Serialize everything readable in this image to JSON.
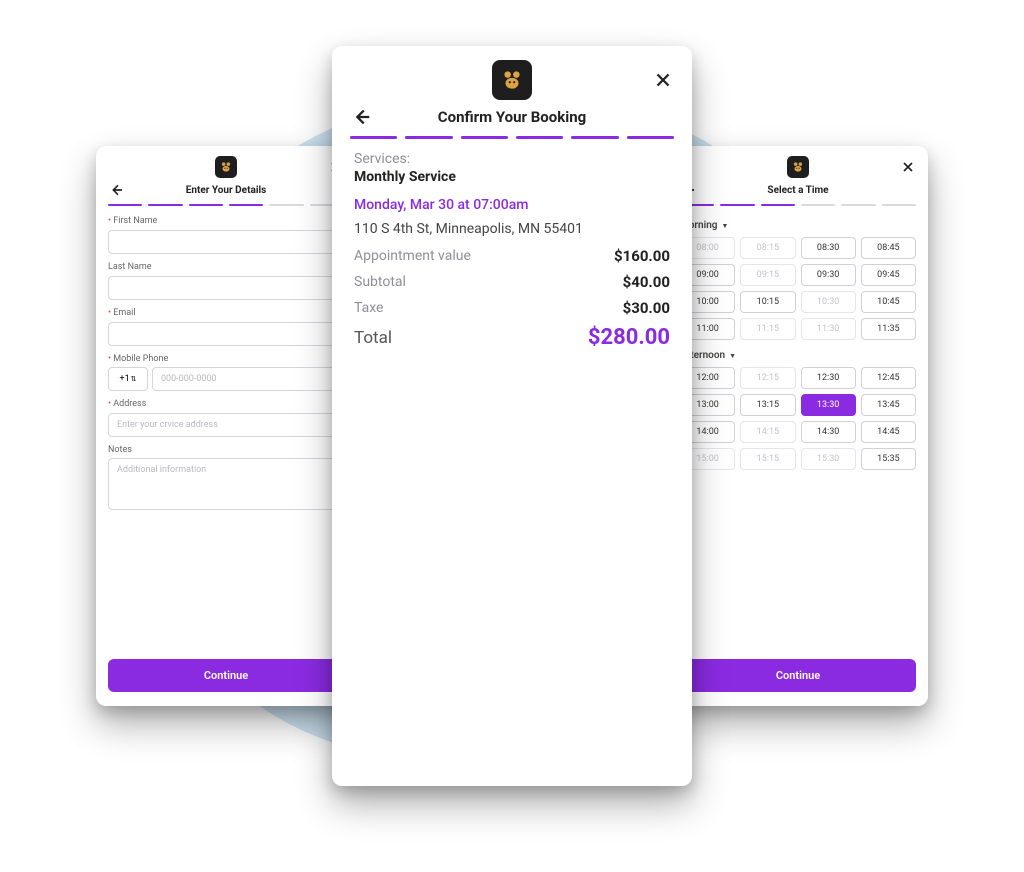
{
  "left": {
    "title": "Enter Your Details",
    "progress": [
      true,
      true,
      true,
      true,
      false,
      false
    ],
    "labels": {
      "first_name": "First Name",
      "last_name": "Last Name",
      "email": "Email",
      "phone": "Mobile Phone",
      "address": "Address",
      "notes": "Notes"
    },
    "phone_cc": "+1",
    "phone_placeholder": "000-000-0000",
    "address_placeholder": "Enter your crvice address",
    "notes_placeholder": "Additional information",
    "continue": "Continue"
  },
  "center": {
    "title": "Confirm Your Booking",
    "progress": [
      true,
      true,
      true,
      true,
      true,
      true
    ],
    "services_label": "Services:",
    "service_name": "Monthly Service",
    "datetime": "Monday, Mar 30 at 07:00am",
    "address": "110 S 4th St, Minneapolis, MN 55401",
    "lines": {
      "appt_label": "Appointment value",
      "appt_value": "$160.00",
      "subtotal_label": "Subtotal",
      "subtotal_value": "$40.00",
      "tax_label": "Taxe",
      "tax_value": "$30.00",
      "total_label": "Total",
      "total_value": "$280.00"
    }
  },
  "right": {
    "title": "Select a Time",
    "progress": [
      true,
      true,
      true,
      false,
      false,
      false
    ],
    "continue": "Continue",
    "groups": [
      {
        "label": "Morning",
        "slots": [
          {
            "t": "08:00",
            "d": true
          },
          {
            "t": "08:15",
            "d": true
          },
          {
            "t": "08:30"
          },
          {
            "t": "08:45"
          },
          {
            "t": "09:00"
          },
          {
            "t": "09:15",
            "d": true
          },
          {
            "t": "09:30"
          },
          {
            "t": "09:45"
          },
          {
            "t": "10:00"
          },
          {
            "t": "10:15"
          },
          {
            "t": "10:30",
            "d": true
          },
          {
            "t": "10:45"
          },
          {
            "t": "11:00"
          },
          {
            "t": "11:15",
            "d": true
          },
          {
            "t": "11:30",
            "d": true
          },
          {
            "t": "11:35"
          }
        ]
      },
      {
        "label": "Afternoon",
        "slots": [
          {
            "t": "12:00"
          },
          {
            "t": "12:15",
            "d": true
          },
          {
            "t": "12:30"
          },
          {
            "t": "12:45"
          },
          {
            "t": "13:00"
          },
          {
            "t": "13:15"
          },
          {
            "t": "13:30",
            "s": true
          },
          {
            "t": "13:45"
          },
          {
            "t": "14:00"
          },
          {
            "t": "14:15",
            "d": true
          },
          {
            "t": "14:30"
          },
          {
            "t": "14:45"
          },
          {
            "t": "15:00",
            "d": true
          },
          {
            "t": "15:15",
            "d": true
          },
          {
            "t": "15:30",
            "d": true
          },
          {
            "t": "15:35"
          }
        ]
      }
    ]
  }
}
